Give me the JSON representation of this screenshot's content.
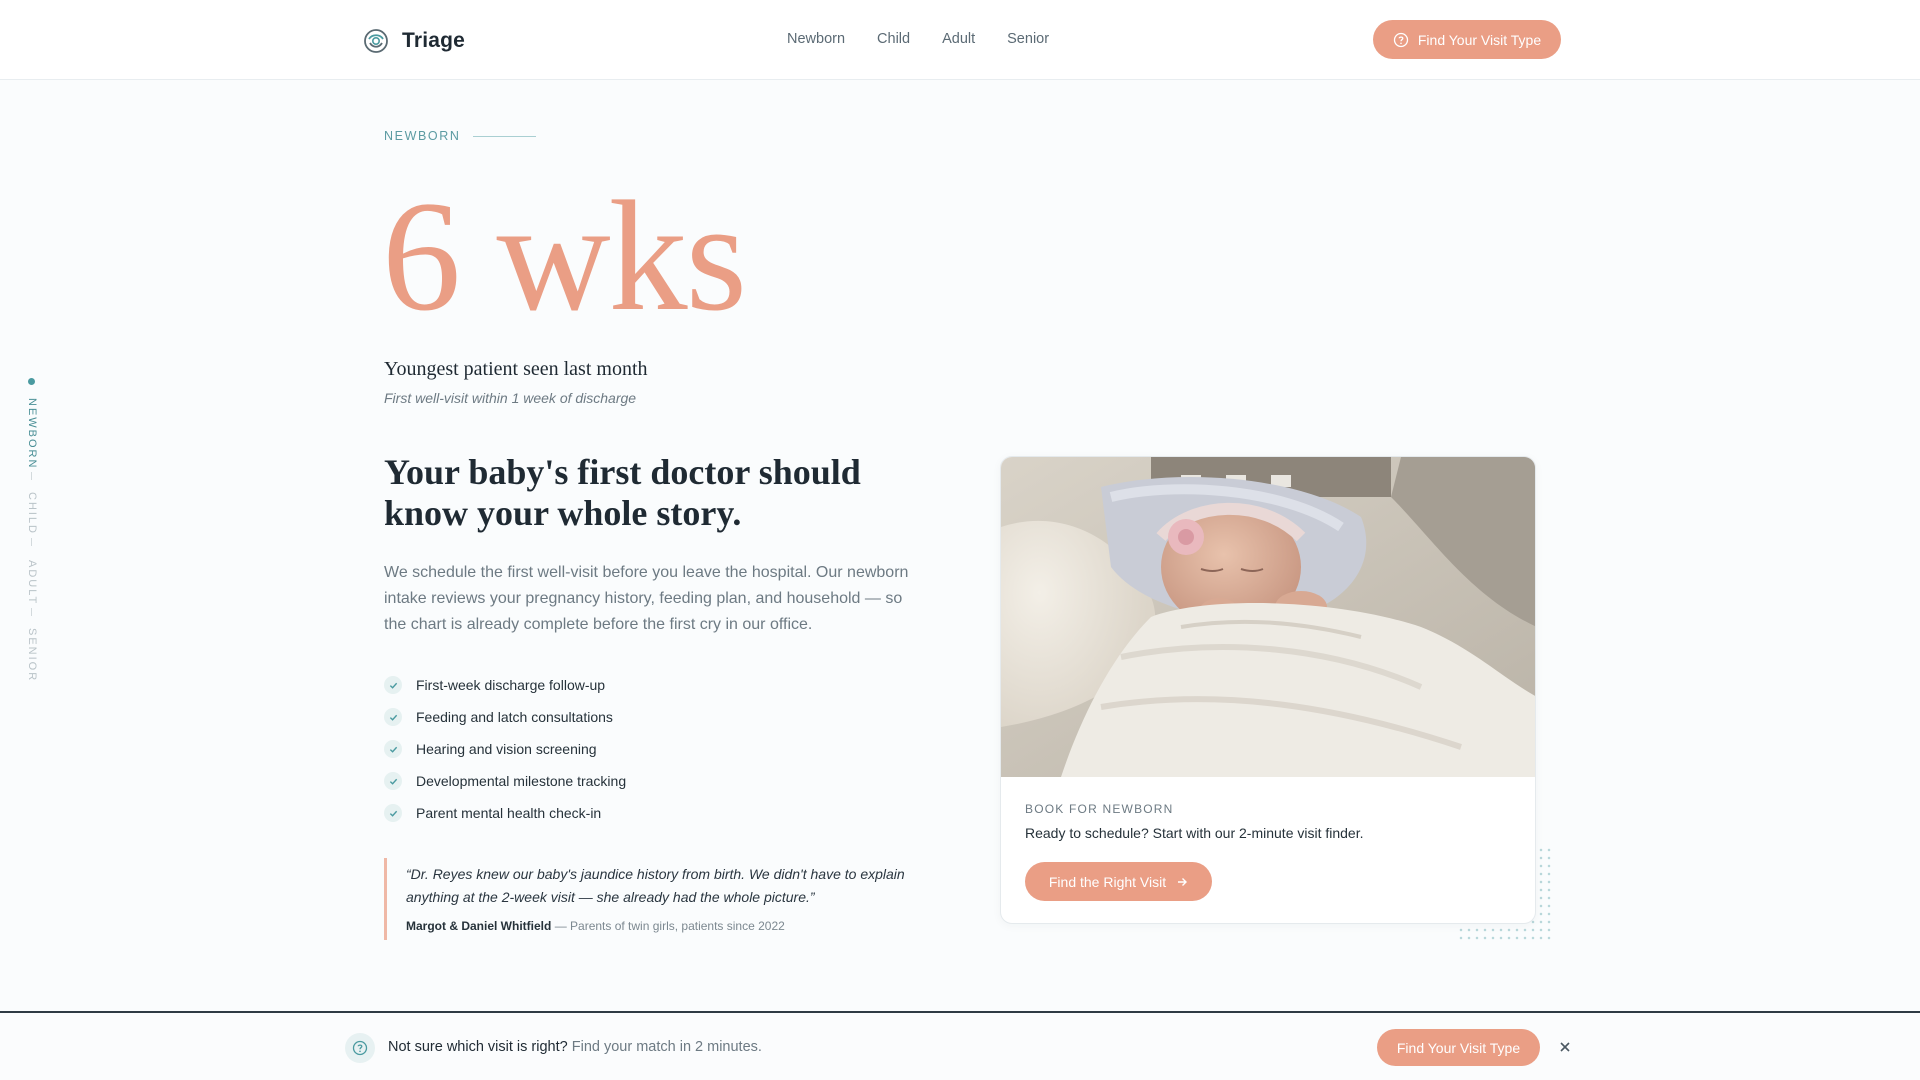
{
  "brand": {
    "name": "Triage"
  },
  "nav": {
    "items": [
      "Newborn",
      "Child",
      "Adult",
      "Senior"
    ]
  },
  "header_cta": {
    "label": "Find Your Visit Type",
    "icon": "help-circle-icon"
  },
  "side_rail": {
    "items": [
      "NEWBORN",
      "CHILD",
      "ADULT",
      "SENIOR"
    ],
    "active": "NEWBORN"
  },
  "section": {
    "label": "NEWBORN",
    "stat_value": "6 wks",
    "stat_caption": "Youngest patient seen last month",
    "stat_sub": "First well-visit within 1 week of discharge",
    "headline": "Your baby's first doctor should know your whole story.",
    "body": "We schedule the first well-visit before you leave the hospital. Our newborn intake reviews your pregnancy history, feeding plan, and household — so the chart is already complete before the first cry in our office.",
    "checklist": [
      "First-week discharge follow-up",
      "Feeding and latch consultations",
      "Hearing and vision screening",
      "Developmental milestone tracking",
      "Parent mental health check-in"
    ],
    "quote": {
      "text": "“Dr. Reyes knew our baby's jaundice history from birth. We didn't have to explain anything at the 2-week visit — she already had the whole picture.”",
      "author": "Margot & Daniel Whitfield",
      "detail": "— Parents of twin girls, patients since 2022"
    }
  },
  "card": {
    "eyebrow": "BOOK FOR NEWBORN",
    "text": "Ready to schedule? Start with our 2-minute visit finder.",
    "button": "Find the Right Visit"
  },
  "bottom_bar": {
    "question": "Not sure which visit is right?",
    "hint": "Find your match in 2 minutes.",
    "button": "Find Your Visit Type"
  },
  "colors": {
    "accent": "#ea9e85",
    "teal": "#4a9aa0",
    "text": "#1f2a33",
    "muted": "#6d7a83"
  }
}
